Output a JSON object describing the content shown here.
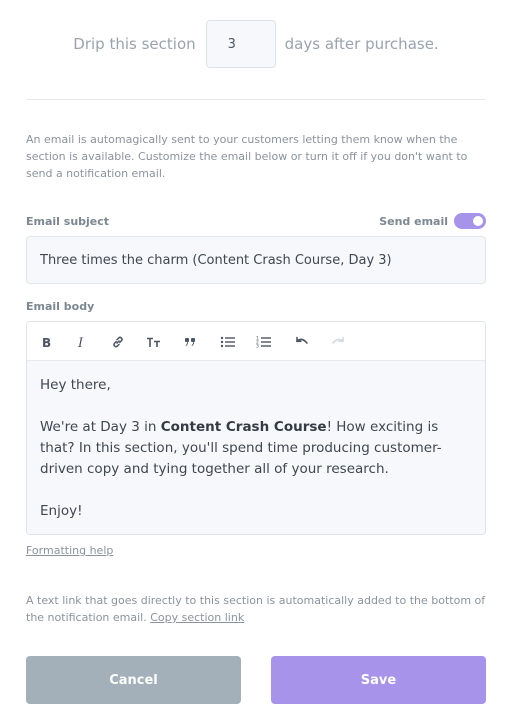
{
  "drip": {
    "prefix": "Drip this section",
    "days_value": "3",
    "suffix": "days after purchase."
  },
  "intro_text": "An email is automagically sent to your customers letting them know when the section is available. Customize the email below or turn it off if you don't want to send a notification email.",
  "subject": {
    "label": "Email subject",
    "value": "Three times the charm (Content Crash Course, Day 3)"
  },
  "send_email": {
    "label": "Send email",
    "enabled": true,
    "accent_color": "#a794ea"
  },
  "body": {
    "label": "Email body",
    "toolbar": [
      "bold-icon",
      "italic-icon",
      "link-icon",
      "heading-icon",
      "quote-icon",
      "bullet-list-icon",
      "numbered-list-icon",
      "undo-icon",
      "redo-icon"
    ],
    "greeting": "Hey there,",
    "para_before": "We're at Day 3 in ",
    "para_bold": "Content Crash Course",
    "para_after": "! How exciting is that? In this section, you'll spend time producing customer-driven copy and tying together all of your research.",
    "signoff": "Enjoy!"
  },
  "formatting_help": "Formatting help",
  "footer": {
    "text": "A text link that goes directly to this section is automatically added to the bottom of the notification email. ",
    "link": "Copy section link"
  },
  "buttons": {
    "cancel": "Cancel",
    "save": "Save"
  }
}
